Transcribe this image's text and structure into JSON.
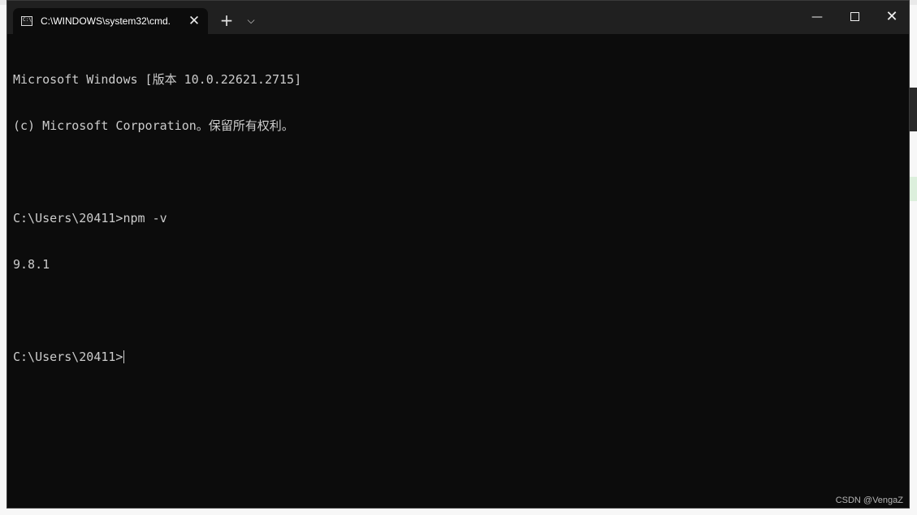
{
  "window": {
    "tab_title": "C:\\WINDOWS\\system32\\cmd.",
    "tab_icon": "cmd-icon",
    "new_tab_label": "+",
    "dropdown_glyph": "⌵",
    "close_tab_glyph": "✕",
    "minimize_glyph": "—",
    "close_glyph": "✕"
  },
  "console": {
    "lines": [
      "Microsoft Windows [版本 10.0.22621.2715]",
      "(c) Microsoft Corporation。保留所有权利。",
      "",
      "C:\\Users\\20411>npm -v",
      "9.8.1",
      "",
      "C:\\Users\\20411>"
    ]
  },
  "watermark": "CSDN @VengaZ",
  "colors": {
    "console_bg": "#0c0c0c",
    "titlebar_bg": "#202020",
    "text": "#cccccc"
  }
}
